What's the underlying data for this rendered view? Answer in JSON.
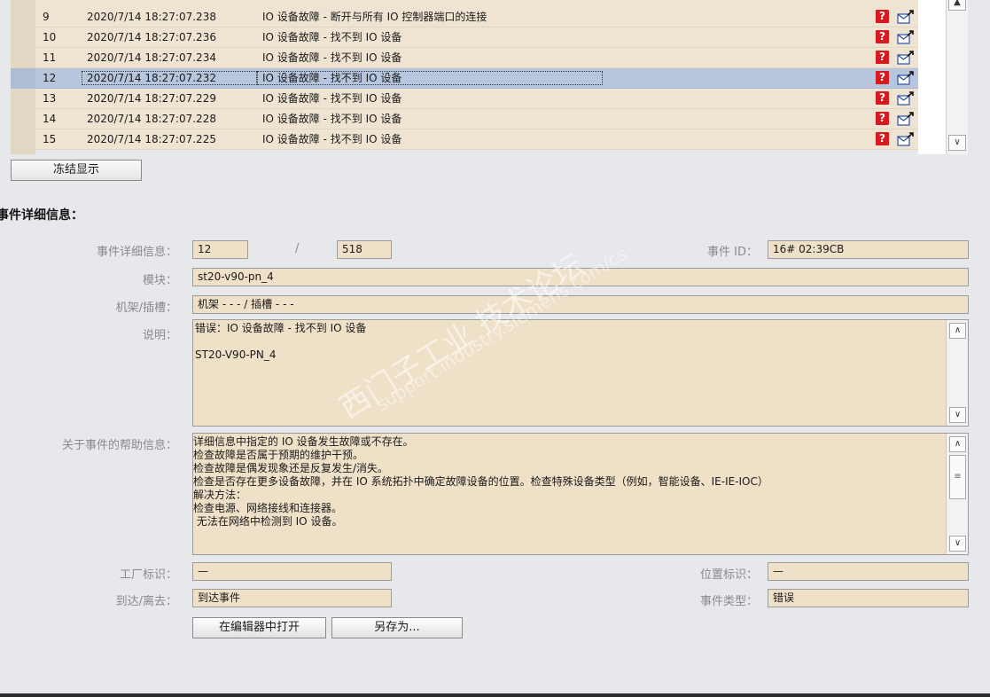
{
  "event_table": {
    "partial_top_row": {
      "text": "...",
      "num": ""
    },
    "rows": [
      {
        "num": "9",
        "timestamp": "2020/7/14 18:27:07.238",
        "description": "IO 设备故障 - 断开与所有 IO 控制器端口的连接",
        "selected": false
      },
      {
        "num": "10",
        "timestamp": "2020/7/14 18:27:07.236",
        "description": "IO 设备故障 - 找不到 IO 设备",
        "selected": false
      },
      {
        "num": "11",
        "timestamp": "2020/7/14 18:27:07.234",
        "description": "IO 设备故障 - 找不到 IO 设备",
        "selected": false
      },
      {
        "num": "12",
        "timestamp": "2020/7/14 18:27:07.232",
        "description": "IO 设备故障 - 找不到 IO 设备",
        "selected": true
      },
      {
        "num": "13",
        "timestamp": "2020/7/14 18:27:07.229",
        "description": "IO 设备故障 - 找不到 IO 设备",
        "selected": false
      },
      {
        "num": "14",
        "timestamp": "2020/7/14 18:27:07.228",
        "description": "IO 设备故障 - 找不到 IO 设备",
        "selected": false
      },
      {
        "num": "15",
        "timestamp": "2020/7/14 18:27:07.225",
        "description": "IO 设备故障 - 找不到 IO 设备",
        "selected": false
      }
    ],
    "help_icon_glyph": "?",
    "freeze_button": "冻结显示"
  },
  "details": {
    "title": "事件详细信息：",
    "event_detail_label": "事件详细信息：",
    "event_index": "12",
    "separator": "/",
    "event_total": "518",
    "event_id_label": "事件 ID：",
    "event_id": "16# 02:39CB",
    "module_label": "模块：",
    "module": "st20-v90-pn_4",
    "rack_slot_label": "机架/插槽：",
    "rack_slot": "机架 - - - / 插槽 - - -",
    "description_label": "说明：",
    "description_text": "错误：IO 设备故障 - 找不到 IO 设备\n\nST20-V90-PN_4",
    "help_label": "关于事件的帮助信息：",
    "help_text": "详细信息中指定的 IO 设备发生故障或不存在。\n检查故障是否属于预期的维护干预。\n检查故障是偶发现象还是反复发生/消失。\n检查是否存在更多设备故障，并在 IO 系统拓扑中确定故障设备的位置。检查特殊设备类型（例如，智能设备、IE-IE-IOC）\n解决方法：\n检查电源、网络接线和连接器。\n 无法在网络中检测到 IO 设备。",
    "plant_id_label": "工厂标识：",
    "plant_id": "—",
    "location_id_label": "位置标识：",
    "location_id": "—",
    "arrive_leave_label": "到达/离去：",
    "arrive_leave": "到达事件",
    "event_type_label": "事件类型：",
    "event_type": "错误",
    "open_editor_button": "在编辑器中打开",
    "save_as_button": "另存为..."
  },
  "watermark": {
    "line1": "西门子工业 技术论坛",
    "line2": "support.industry.siemens.com/cs"
  },
  "colors": {
    "row_bg": "#efe4d1",
    "selected_bg": "#b8c6dd",
    "field_bg": "#efe0c8",
    "help_icon": "#d71920"
  }
}
